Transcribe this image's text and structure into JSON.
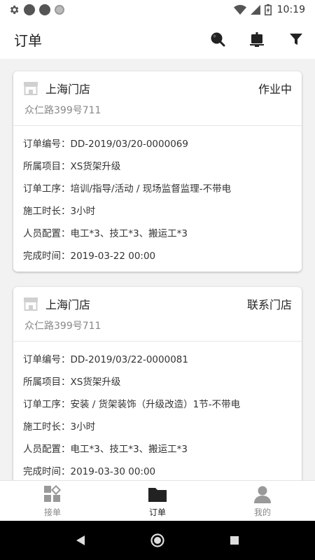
{
  "status_bar": {
    "time": "10:19"
  },
  "app_bar": {
    "title": "订单"
  },
  "orders": [
    {
      "store": "上海门店",
      "status": "作业中",
      "address": "众仁路399号711",
      "fields": [
        "订单编号：DD-2019/03/20-0000069",
        "所属项目：XS货架升级",
        "订单工序：培训/指导/活动 / 现场监督监理-不带电",
        "施工时长：3小时",
        "人员配置：电工*3、技工*3、搬运工*3",
        "完成时间：2019-03-22 00:00"
      ]
    },
    {
      "store": "上海门店",
      "status": "联系门店",
      "address": "众仁路399号711",
      "fields": [
        "订单编号：DD-2019/03/22-0000081",
        "所属项目：XS货架升级",
        "订单工序：安装 / 货架装饰（升级改造）1节-不带电",
        "施工时长：3小时",
        "人员配置：电工*3、技工*3、搬运工*3",
        "完成时间：2019-03-30 00:00"
      ]
    }
  ],
  "tabs": [
    {
      "label": "接单"
    },
    {
      "label": "订单"
    },
    {
      "label": "我的"
    }
  ]
}
